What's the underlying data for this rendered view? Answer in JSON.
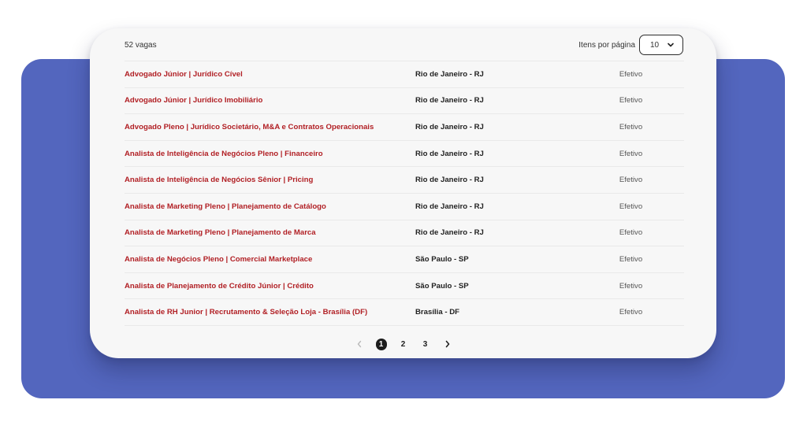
{
  "colors": {
    "background_panel": "#5366be",
    "card": "#f7f7f7",
    "job_title": "#b11f24"
  },
  "listing": {
    "count_label": "52 vagas",
    "per_page_label": "Itens por página",
    "per_page_value": "10"
  },
  "jobs": [
    {
      "title": "Advogado Júnior | Jurídico Cível",
      "location": "Rio de Janeiro - RJ",
      "type": "Efetivo"
    },
    {
      "title": "Advogado Júnior | Jurídico Imobiliário",
      "location": "Rio de Janeiro - RJ",
      "type": "Efetivo"
    },
    {
      "title": "Advogado Pleno | Jurídico Societário, M&A e Contratos Operacionais",
      "location": "Rio de Janeiro - RJ",
      "type": "Efetivo"
    },
    {
      "title": "Analista de Inteligência de Negócios Pleno | Financeiro",
      "location": "Rio de Janeiro - RJ",
      "type": "Efetivo"
    },
    {
      "title": "Analista de Inteligência de Negócios Sênior | Pricing",
      "location": "Rio de Janeiro - RJ",
      "type": "Efetivo"
    },
    {
      "title": "Analista de Marketing Pleno | Planejamento de Catálogo",
      "location": "Rio de Janeiro - RJ",
      "type": "Efetivo"
    },
    {
      "title": "Analista de Marketing Pleno | Planejamento de Marca",
      "location": "Rio de Janeiro - RJ",
      "type": "Efetivo"
    },
    {
      "title": "Analista de Negócios Pleno | Comercial Marketplace",
      "location": "São Paulo - SP",
      "type": "Efetivo"
    },
    {
      "title": "Analista de Planejamento de Crédito Júnior | Crédito",
      "location": "São Paulo - SP",
      "type": "Efetivo"
    },
    {
      "title": "Analista de RH Junior | Recrutamento & Seleção Loja - Brasília (DF)",
      "location": "Brasília - DF",
      "type": "Efetivo"
    }
  ],
  "pagination": {
    "prev_icon": "chevron-left-icon",
    "next_icon": "chevron-right-icon",
    "pages": [
      "1",
      "2",
      "3"
    ],
    "current": "1"
  }
}
